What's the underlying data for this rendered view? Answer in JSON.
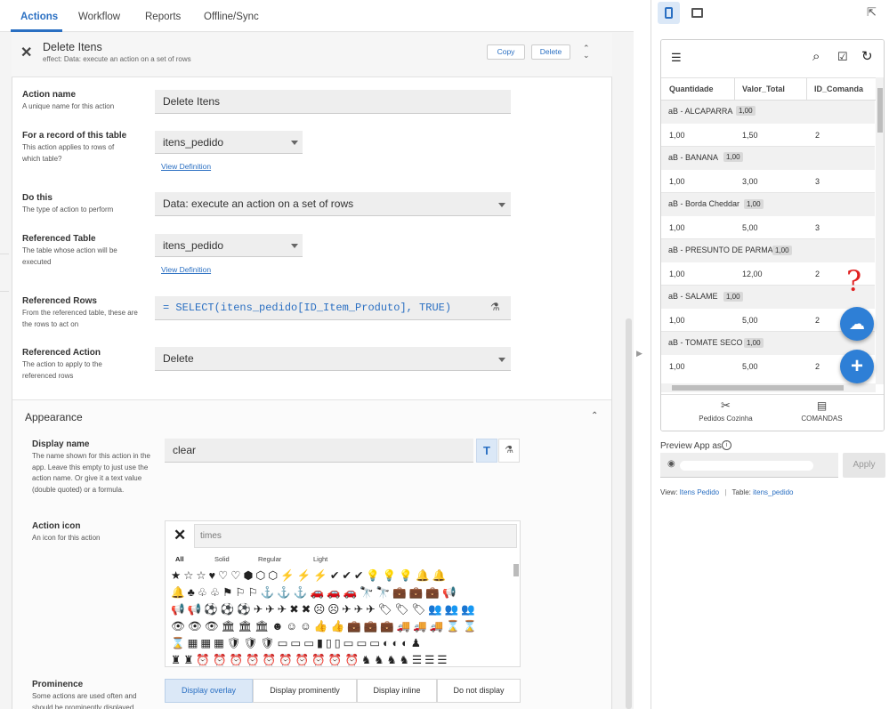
{
  "tabs": [
    {
      "label": "Actions"
    },
    {
      "label": "Workflow"
    },
    {
      "label": "Reports"
    },
    {
      "label": "Offline/Sync"
    }
  ],
  "header": {
    "title": "Delete Itens",
    "subtitle": "effect: Data: execute an action on a set of rows",
    "copy_label": "Copy",
    "delete_label": "Delete"
  },
  "form": {
    "action_name": {
      "label": "Action name",
      "hint": "A unique name for this action",
      "value": "Delete Itens"
    },
    "record_table": {
      "label": "For a record of this table",
      "hint": "This action applies to rows of which table?",
      "value": "itens_pedido",
      "link": "View Definition"
    },
    "do_this": {
      "label": "Do this",
      "hint": "The type of action to perform",
      "value": "Data: execute an action on a set of rows"
    },
    "referenced_table": {
      "label": "Referenced Table",
      "hint": "The table whose action will be executed",
      "value": "itens_pedido",
      "link": "View Definition"
    },
    "referenced_rows": {
      "label": "Referenced Rows",
      "hint": "From the referenced table, these are the rows to act on",
      "value": "=  SELECT(itens_pedido[ID_Item_Produto], TRUE)"
    },
    "referenced_action": {
      "label": "Referenced Action",
      "hint": "The action to apply to the referenced rows",
      "value": "Delete"
    }
  },
  "appearance": {
    "section_title": "Appearance",
    "display_name": {
      "label": "Display name",
      "hint": "The name shown for this action in the app. Leave this empty to just use the action name. Or give it a text value (double quoted) or a formula.",
      "value": "clear"
    },
    "action_icon": {
      "label": "Action icon",
      "hint": "An icon for this action",
      "search_value": "times",
      "filters": [
        "All",
        "Solid",
        "Regular",
        "Light"
      ]
    },
    "prominence": {
      "label": "Prominence",
      "hint": "Some actions are used often and should be prominently displayed",
      "options": [
        "Display overlay",
        "Display prominently",
        "Display inline",
        "Do not display"
      ],
      "selected": "Display overlay"
    }
  },
  "icon_grid": [
    "★☆☆♥♡♡⬢⬡⬡⚡⚡⚡✔✔✔💡💡💡🔔🔔",
    "🔔♣♧♧⚑⚐⚐⚓⚓⚓🚗🚗🚗🔭🔭💼💼💼📢",
    "📢📢⚽⚽⚽✈✈✈✖✖☹☹✈✈✈🏷🏷🏷👥👥👥",
    "👁👁👁🏛🏛🏛☻☺☺👍👍💼💼💼🚚🚚🚚⌛⌛",
    "⌛▦▦▦🛡🛡🛡▭▭▭▮▯▯▭▭▭◐◐◐♟",
    "♜♜⏰⏰⏰⏰⏰⏰⏰⏰⏰⏰♞♞♞♞☰☰☰"
  ],
  "preview": {
    "columns": [
      "Quantidade",
      "Valor_Total",
      "ID_Comanda"
    ],
    "groups": [
      {
        "name": "aB - ALCAPARRA",
        "chip": "1,00",
        "row": [
          "1,00",
          "1,50",
          "2"
        ]
      },
      {
        "name": "aB - BANANA",
        "chip": "1,00",
        "row": [
          "1,00",
          "3,00",
          "3"
        ]
      },
      {
        "name": "aB - Borda Cheddar",
        "chip": "1,00",
        "row": [
          "1,00",
          "5,00",
          "3"
        ]
      },
      {
        "name": "aB - PRESUNTO DE PARMA",
        "chip": "1,00",
        "row": [
          "1,00",
          "12,00",
          "2"
        ]
      },
      {
        "name": "aB - SALAME",
        "chip": "1,00",
        "row": [
          "1,00",
          "5,00",
          "2"
        ]
      },
      {
        "name": "aB - TOMATE SECO",
        "chip": "1,00",
        "row": [
          "1,00",
          "5,00",
          "2"
        ]
      }
    ],
    "annotation": "?",
    "nav": [
      {
        "label": "Pedidos Cozinha"
      },
      {
        "label": "COMANDAS"
      }
    ],
    "preview_as_label": "Preview App as",
    "apply_label": "Apply",
    "view_label": "View:",
    "view_value": "Itens Pedido",
    "table_label": "Table:",
    "table_value": "itens_pedido"
  },
  "colors": {
    "accent": "#2a6fc2",
    "fab": "#2e7fd6",
    "annotation": "#e02020"
  }
}
